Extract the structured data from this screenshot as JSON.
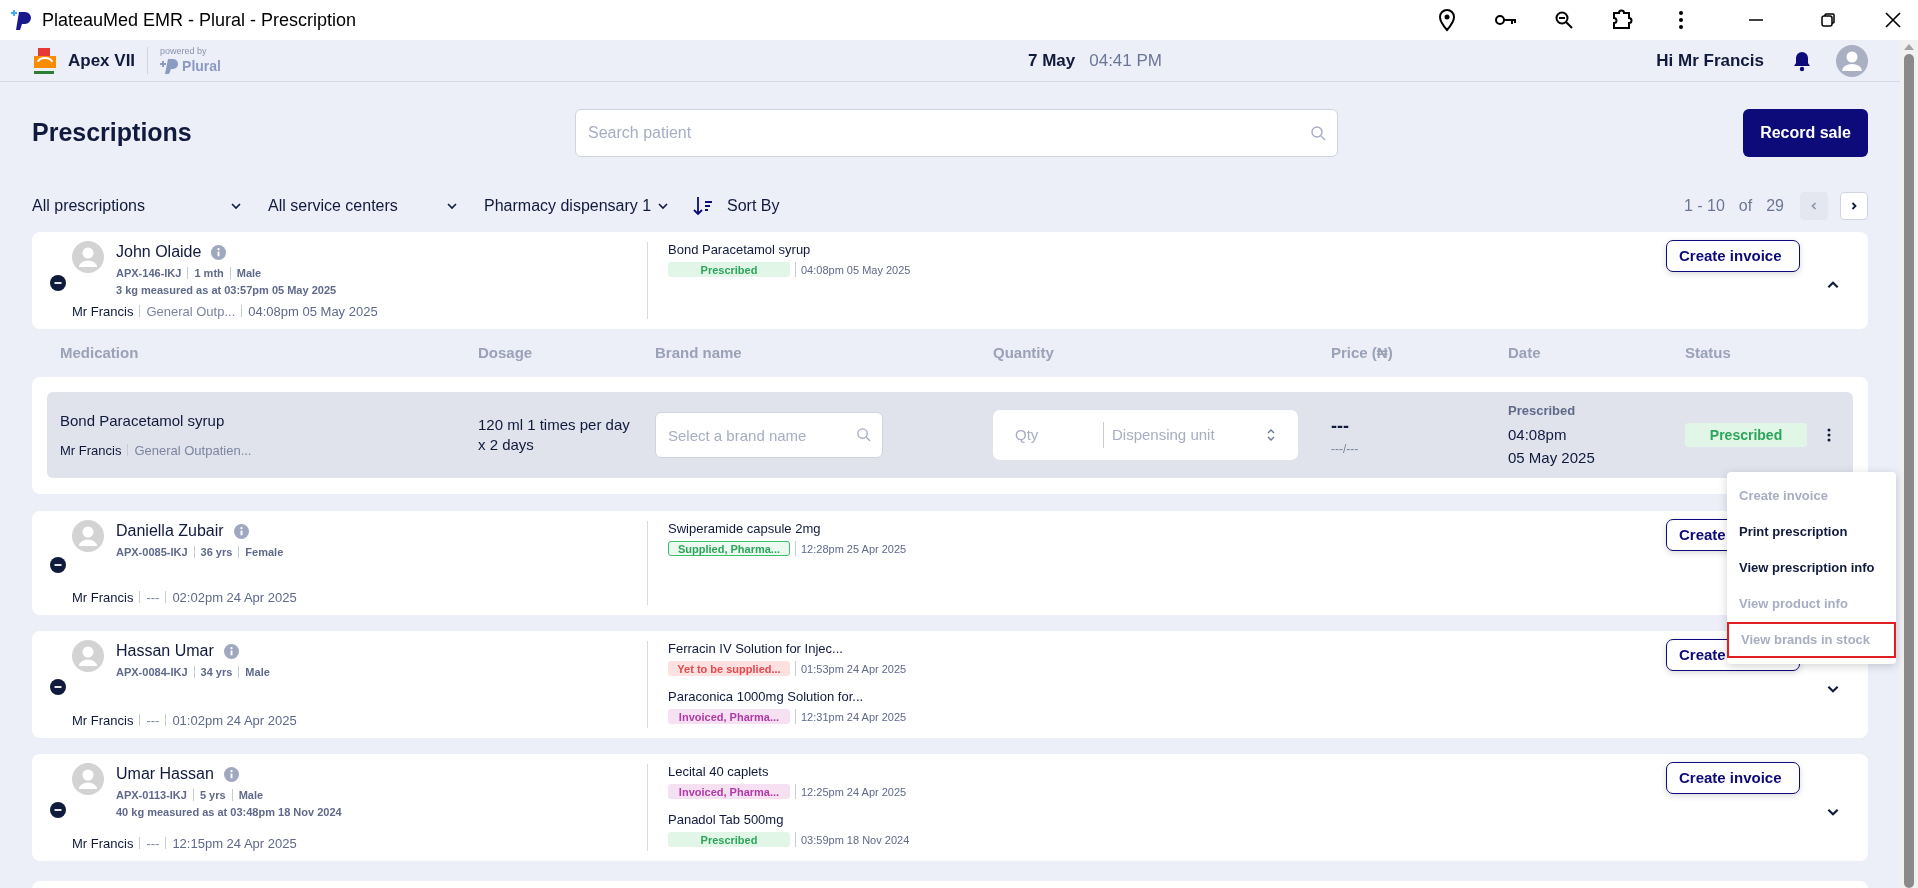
{
  "window": {
    "title": "PlateauMed EMR - Plural - Prescription"
  },
  "header": {
    "brand": "Apex VII",
    "powered_label": "powered by",
    "powered_brand": "Plural",
    "date": "7 May",
    "time": "04:41 PM",
    "greeting": "Hi Mr Francis"
  },
  "page": {
    "title": "Prescriptions",
    "search": {
      "placeholder": "Search patient"
    },
    "record_button": "Record sale"
  },
  "filters": [
    "All prescriptions",
    "All service centers",
    "Pharmacy dispensary 1"
  ],
  "sort_label": "Sort By",
  "pagination": {
    "range": "1 - 10",
    "of": "of",
    "total": "29",
    "prev_disabled": true
  },
  "patients": [
    {
      "name": "John Olaide",
      "meta": [
        "APX-146-IKJ",
        "1 mth",
        "Male"
      ],
      "weight": "3 kg measured as at 03:57pm 05 May 2025",
      "doctor": "Mr Francis",
      "center": "General Outp...",
      "time": "04:08pm 05 May 2025",
      "invoice_label": "Create invoice",
      "expanded": true,
      "medications": [
        {
          "name": "Bond Paracetamol syrup",
          "status": {
            "label": "Prescribed",
            "kind": "prescribed"
          },
          "time": "04:08pm 05 May 2025"
        }
      ]
    },
    {
      "name": "Daniella Zubair",
      "meta": [
        "APX-0085-IKJ",
        "36 yrs",
        "Female"
      ],
      "doctor": "Mr Francis",
      "center": "---",
      "time": "02:02pm 24 Apr 2025",
      "invoice_label": "Create",
      "medications": [
        {
          "name": "Swiperamide capsule 2mg",
          "status": {
            "label": "Supplied, Pharma...",
            "kind": "supplied"
          },
          "time": "12:28pm 25 Apr 2025"
        }
      ]
    },
    {
      "name": "Hassan Umar",
      "meta": [
        "APX-0084-IKJ",
        "34 yrs",
        "Male"
      ],
      "doctor": "Mr Francis",
      "center": "---",
      "time": "01:02pm 24 Apr 2025",
      "invoice_label": "Create",
      "expanded": false,
      "medications": [
        {
          "name": "Ferracin IV Solution for Injec...",
          "status": {
            "label": "Yet to be supplied...",
            "kind": "pending"
          },
          "time": "01:53pm 24 Apr 2025"
        },
        {
          "name": "Paraconica 1000mg Solution for...",
          "status": {
            "label": "Invoiced, Pharma...",
            "kind": "invoiced"
          },
          "time": "12:31pm 24 Apr 2025"
        }
      ]
    },
    {
      "name": "Umar Hassan",
      "meta": [
        "APX-0113-IKJ",
        "5 yrs",
        "Male"
      ],
      "weight": "40 kg measured as at 03:48pm 18 Nov 2024",
      "doctor": "Mr Francis",
      "center": "---",
      "time": "12:15pm 24 Apr 2025",
      "invoice_label": "Create invoice",
      "expanded": false,
      "medications": [
        {
          "name": "Lecital 40 caplets",
          "status": {
            "label": "Invoiced, Pharma...",
            "kind": "invoiced"
          },
          "time": "12:25pm 24 Apr 2025"
        },
        {
          "name": "Panadol Tab 500mg",
          "status": {
            "label": "Prescribed",
            "kind": "prescribed"
          },
          "time": "03:59pm 18 Nov 2024"
        }
      ]
    }
  ],
  "detail": {
    "columns": [
      "Medication",
      "Dosage",
      "Brand name",
      "Quantity",
      "Price (₦)",
      "Date",
      "Status"
    ],
    "row": {
      "medication": "Bond Paracetamol syrup",
      "doctor": "Mr Francis",
      "center": "General Outpatien...",
      "dosage": "120 ml 1 times per day x 2 days",
      "brand_placeholder": "Select a brand name",
      "qty_placeholder": "Qty",
      "unit_placeholder": "Dispensing unit",
      "price": "---",
      "unit_price": "---/---",
      "date_label": "Prescribed",
      "date_time": "04:08pm",
      "date_day": "05 May 2025",
      "status": {
        "label": "Prescribed",
        "kind": "prescribed"
      }
    }
  },
  "menu": [
    {
      "label": "Create invoice",
      "disabled": true,
      "highlighted": false
    },
    {
      "label": "Print prescription",
      "disabled": false,
      "highlighted": false
    },
    {
      "label": "View prescription info",
      "disabled": false,
      "highlighted": false
    },
    {
      "label": "View product info",
      "disabled": true,
      "highlighted": false
    },
    {
      "label": "View brands in stock",
      "disabled": true,
      "highlighted": true
    }
  ]
}
